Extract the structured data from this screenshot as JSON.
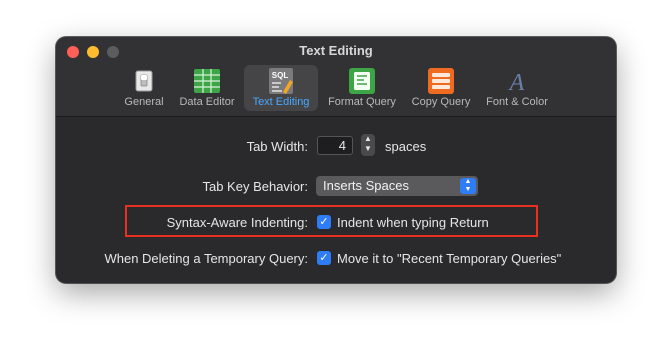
{
  "window": {
    "title": "Text Editing"
  },
  "toolbar": {
    "tabs": [
      {
        "label": "General",
        "icon": "general-switch-icon"
      },
      {
        "label": "Data Editor",
        "icon": "grid-table-icon"
      },
      {
        "label": "Text Editing",
        "icon": "sql-pencil-icon",
        "icon_text": "SQL",
        "active": true
      },
      {
        "label": "Format Query",
        "icon": "format-doc-icon"
      },
      {
        "label": "Copy Query",
        "icon": "copy-list-icon"
      },
      {
        "label": "Font & Color",
        "icon": "font-a-icon",
        "icon_text": "A"
      }
    ]
  },
  "settings": {
    "tab_width": {
      "label": "Tab Width:",
      "value": "4",
      "unit": "spaces"
    },
    "tab_key": {
      "label": "Tab Key Behavior:",
      "value": "Inserts Spaces"
    },
    "syntax_indent": {
      "label": "Syntax-Aware Indenting:",
      "checkbox_label": "Indent when typing Return",
      "checked": true
    },
    "delete_temp": {
      "label": "When Deleting a Temporary Query:",
      "checkbox_label": "Move it to \"Recent Temporary Queries\"",
      "checked": true
    }
  },
  "colors": {
    "accent": "#2f7df6",
    "highlight": "#e8321f",
    "active_tab_text": "#4aa8ff"
  }
}
